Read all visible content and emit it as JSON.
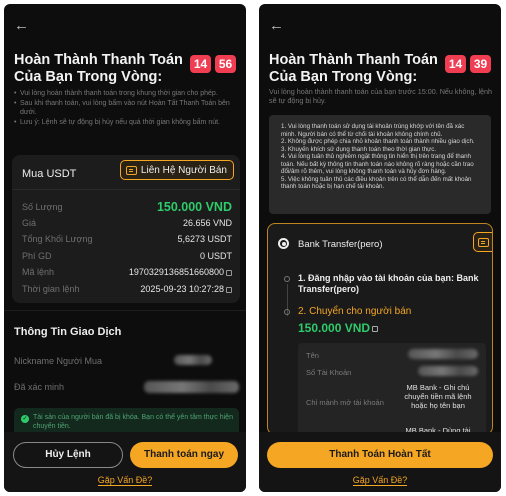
{
  "colors": {
    "accent": "#f5a623",
    "timer": "#f03d52",
    "success": "#2ecb6b",
    "background": "#0d0d0d"
  },
  "left": {
    "back_icon": "arrow-left-icon",
    "title": "Hoàn Thành Thanh Toán Của Bạn Trong Vòng:",
    "timer": {
      "minutes": "14",
      "seconds": "56"
    },
    "notes": [
      "Vui lòng hoàn thành thanh toán trong khung thời gian cho phép.",
      "Sau khi thanh toán, vui lòng bấm vào nút Hoàn Tất Thanh Toán bên dưới.",
      "Lưu ý: Lệnh sẽ tự động bị hủy nếu quá thời gian không bấm nút."
    ],
    "order": {
      "heading": "Mua USDT",
      "contact_label": "Liên Hệ Người Bán",
      "rows": [
        {
          "label": "Số Lượng",
          "value": "150.000 VND"
        },
        {
          "label": "Giá",
          "value": "26.656 VND"
        },
        {
          "label": "Tổng Khối Lượng",
          "value": "5,6273 USDT"
        },
        {
          "label": "Phí GD",
          "value": "0 USDT"
        },
        {
          "label": "Mã lệnh",
          "value": "1970329136851660800"
        },
        {
          "label": "Thời gian lệnh",
          "value": "2025-09-23 10:27:28"
        }
      ]
    },
    "trade_info": {
      "title": "Thông Tin Giao Dịch",
      "buyer_label": "Nickname Người Mua",
      "verified_label": "Đã xác minh",
      "notice": "Tài sản của người bán đã bị khóa. Bạn có thể yên tâm thực hiện chuyển tiền."
    },
    "cancel_label": "Hủy Lệnh",
    "pay_label": "Thanh toán ngay",
    "help_label": "Gặp Vấn Đề?"
  },
  "right": {
    "back_icon": "arrow-left-icon",
    "title": "Hoàn Thành Thanh Toán Của Bạn Trong Vòng:",
    "timer": {
      "minutes": "14",
      "seconds": "39"
    },
    "subtitle": "Vui lòng hoàn thành thanh toán của bạn trước 15:00. Nếu không, lệnh sẽ tự động bị hủy.",
    "rules": [
      "1. Vui lòng thanh toán sử dụng tài khoản trùng khớp với tên đã xác minh. Người bán có thể từ chối tài khoản không chính chủ.",
      "2. Không được phép chia nhỏ khoản thanh toán thành nhiều giao dịch.",
      "3. Khuyến khích sử dụng thanh toán theo thời gian thực.",
      "4. Vui lòng tuân thủ nghiêm ngặt thông tin hiển thị trên trang để thanh toán. Nếu bất kỳ thông tin thanh toán nào không rõ ràng hoặc cần trao đổi/âm rõ thêm, vui lòng không thanh toán và hủy đơn hàng.",
      "5. Việc không tuân thủ các điều khoản trên có thể dẫn đến mất khoản thanh toán hoặc bị hạn chế tài khoản."
    ],
    "method": {
      "name": "Bank Transfer(pero)",
      "step1": "1. Đăng nhập vào tài khoản của bạn: Bank Transfer(pero)",
      "step2_label": "2. Chuyển cho người bán",
      "step2_amount": "150.000 VND",
      "details": [
        {
          "label": "Tên",
          "value": ""
        },
        {
          "label": "Số Tài Khoản",
          "value": ""
        },
        {
          "label": "Chỉ mành mở tài khoản",
          "value": "MB Bank - Ghi chú chuyển tiền mã lệnh hoặc họ tên bạn"
        },
        {
          "label": "",
          "value": "MB Bank - Dùng tài"
        }
      ]
    },
    "complete_label": "Thanh Toán Hoàn Tất",
    "help_label": "Gặp Vấn Đề?"
  }
}
